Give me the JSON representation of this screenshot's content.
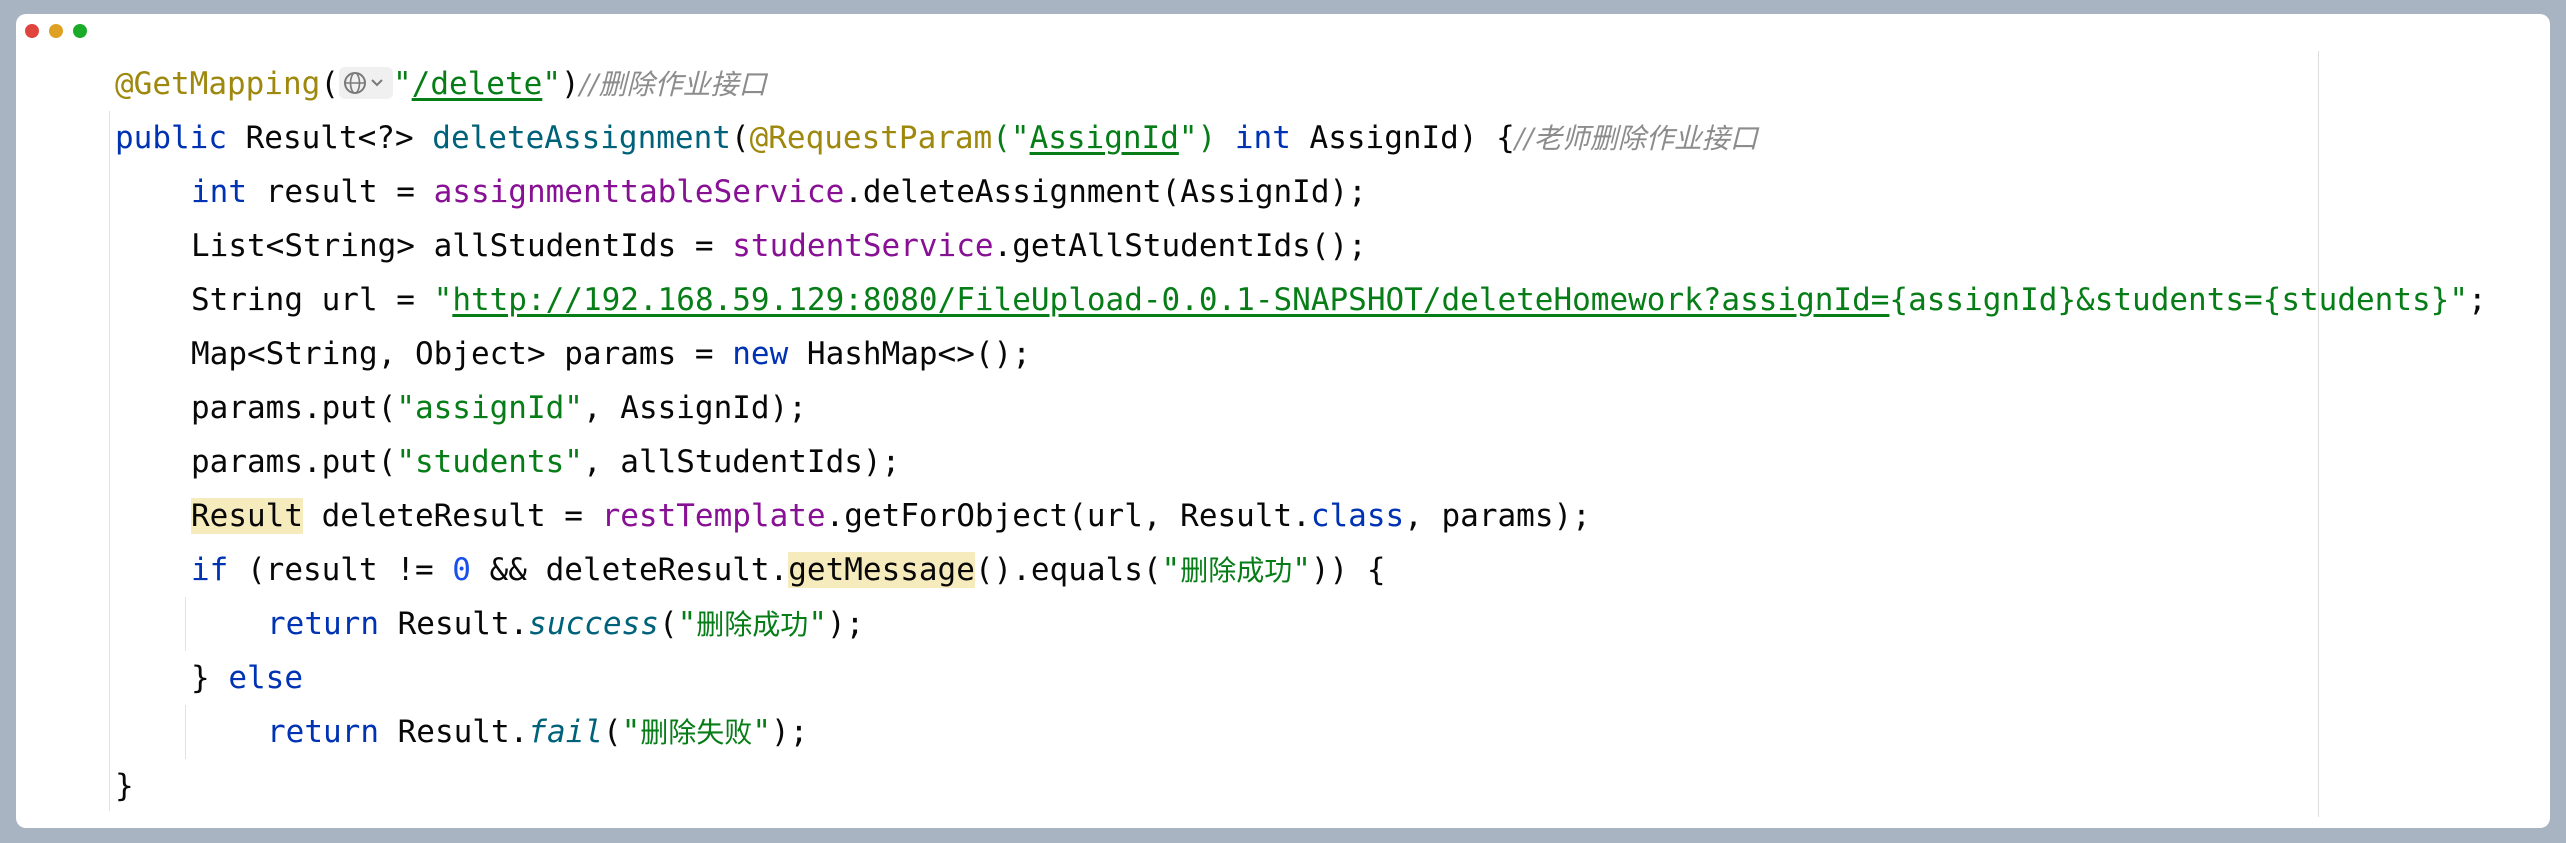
{
  "window": {
    "controls": [
      "close",
      "minimize",
      "maximize"
    ],
    "colors": {
      "close": "#e0443e",
      "minimize": "#dea123",
      "maximize": "#1aab29"
    }
  },
  "editor": {
    "icons": {
      "annotation_hint": "globe-dropdown-icon"
    },
    "theme_colors": {
      "keyword": "#0033b3",
      "annotation": "#9e880d",
      "string": "#067d17",
      "comment": "#8c8c8c",
      "method_decl": "#00627a",
      "field": "#871094",
      "number": "#1750eb",
      "highlight": "#f6ebbc"
    },
    "code": {
      "l1": {
        "annotation": "@GetMapping",
        "open": "(",
        "q1": "\"",
        "path": "/delete",
        "q2": "\"",
        "close": ")",
        "comment": "//删除作业接口"
      },
      "l2": {
        "kw_public": "public",
        "type": " Result<?> ",
        "method": "deleteAssignment",
        "p1": "(",
        "ann": "@RequestParam",
        "p2": "(\"",
        "param_name": "AssignId",
        "p3": "\") ",
        "kw_int": "int",
        "rest": " AssignId) {",
        "comment": "//老师删除作业接口"
      },
      "l3": {
        "kw_int": "int",
        "a": " result = ",
        "field": "assignmenttableService",
        "b": ".deleteAssignment(AssignId);"
      },
      "l4": {
        "a": "List<String> allStudentIds = ",
        "field": "studentService",
        "b": ".getAllStudentIds();"
      },
      "l5": {
        "a": "String url = ",
        "q1": "\"",
        "url": "http://192.168.59.129:8080/FileUpload-0.0.1-SNAPSHOT/deleteHomework?assignId=",
        "tail": "{assignId}&students={students}\"",
        "semi": ";"
      },
      "l6": {
        "a": "Map<String, Object> params = ",
        "kw_new": "new",
        "b": " HashMap<>();"
      },
      "l7": {
        "a": "params.put(",
        "str": "\"assignId\"",
        "b": ", AssignId);"
      },
      "l8": {
        "a": "params.put(",
        "str": "\"students\"",
        "b": ", allStudentIds);"
      },
      "l9": {
        "hl_type": "Result",
        "a": " deleteResult = ",
        "field": "restTemplate",
        "b": ".getForObject(url, Result.",
        "kw_class": "class",
        "c": ", params);"
      },
      "l10": {
        "kw_if": "if",
        "a": " (result != ",
        "num": "0",
        "b": " && deleteResult.",
        "hl_method": "getMessage",
        "c": "().equals(",
        "q1": "\"",
        "str": "删除成功",
        "q2": "\"",
        "d": ")) {"
      },
      "l11": {
        "kw_return": "return",
        "a": " Result.",
        "method": "success",
        "b": "(",
        "q1": "\"",
        "str": "删除成功",
        "q2": "\"",
        "c": ");"
      },
      "l12": {
        "a": "} ",
        "kw_else": "else"
      },
      "l13": {
        "kw_return": "return",
        "a": " Result.",
        "method": "fail",
        "b": "(",
        "q1": "\"",
        "str": "删除失败",
        "q2": "\"",
        "c": ");"
      },
      "l14": {
        "a": "}"
      }
    }
  }
}
